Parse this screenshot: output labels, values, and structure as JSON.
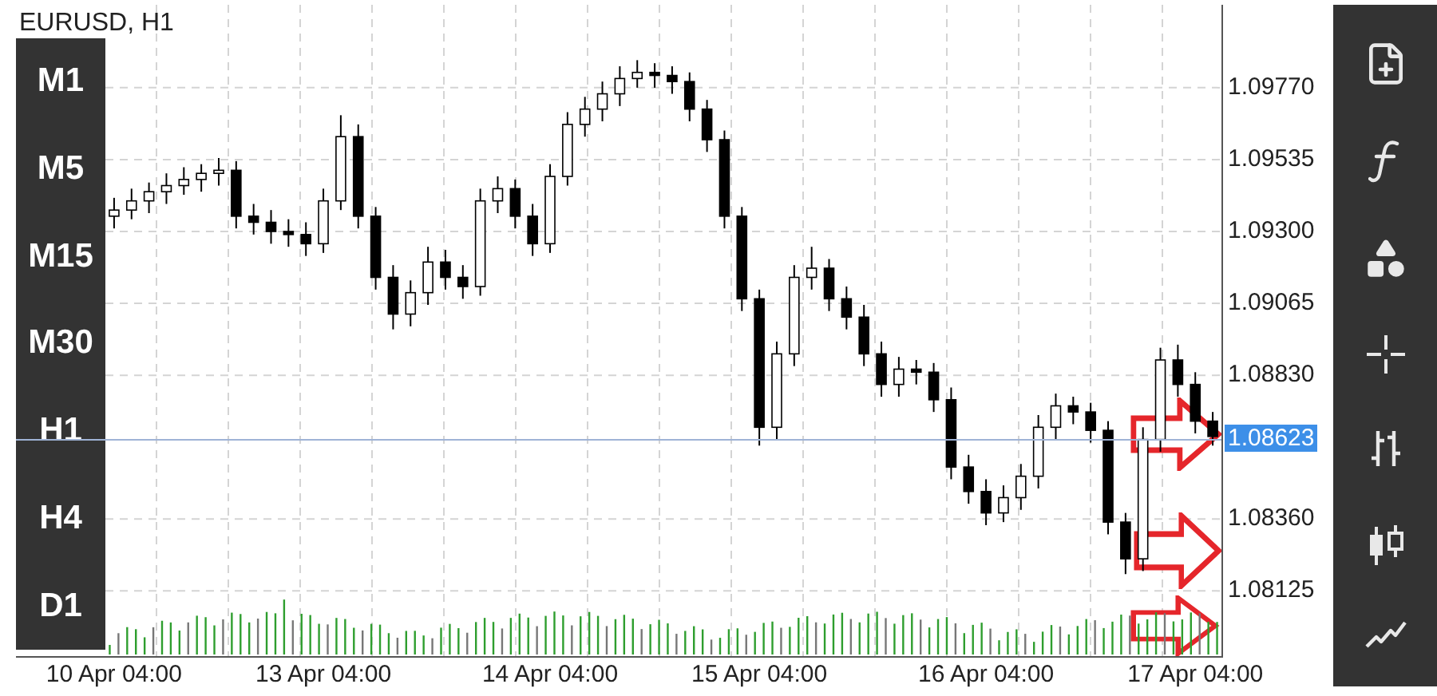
{
  "chart": {
    "title": "EURUSD, H1",
    "timeframes": [
      {
        "label": "M1"
      },
      {
        "label": "M5"
      },
      {
        "label": "M15"
      },
      {
        "label": "M30"
      },
      {
        "label": "H1"
      },
      {
        "label": "H4"
      },
      {
        "label": "D1"
      }
    ],
    "current_price": "1.08623",
    "chart_data": {
      "type": "candlestick",
      "categories": [
        "10 Apr 04:00",
        null,
        null,
        null,
        null,
        null,
        null,
        null,
        null,
        null,
        null,
        null,
        "13 Apr 04:00",
        null,
        null,
        null,
        null,
        null,
        null,
        null,
        null,
        null,
        null,
        null,
        null,
        "14 Apr 04:00",
        null,
        null,
        null,
        null,
        null,
        null,
        null,
        null,
        null,
        null,
        null,
        "15 Apr 04:00",
        null,
        null,
        null,
        null,
        null,
        null,
        null,
        null,
        null,
        null,
        null,
        null,
        "16 Apr 04:00",
        null,
        null,
        null,
        null,
        null,
        null,
        null,
        null,
        null,
        null,
        null,
        "17 Apr 04:00",
        null
      ],
      "ylim": [
        1.07912,
        1.10041
      ],
      "grid": true,
      "ohlc": [
        [
          1.0935,
          1.0941,
          1.0931,
          1.0937
        ],
        [
          1.0937,
          1.0944,
          1.0934,
          1.094
        ],
        [
          1.094,
          1.0946,
          1.0936,
          1.0943
        ],
        [
          1.0943,
          1.0949,
          1.0939,
          1.0945
        ],
        [
          1.0945,
          1.0951,
          1.0942,
          1.0947
        ],
        [
          1.0947,
          1.0952,
          1.0943,
          1.0949
        ],
        [
          1.0949,
          1.0954,
          1.0945,
          1.095
        ],
        [
          1.095,
          1.0953,
          1.0931,
          1.0935
        ],
        [
          1.0935,
          1.0939,
          1.0929,
          1.0933
        ],
        [
          1.0933,
          1.0937,
          1.0926,
          1.093
        ],
        [
          1.093,
          1.0934,
          1.0925,
          1.0929
        ],
        [
          1.0929,
          1.0933,
          1.0922,
          1.0926
        ],
        [
          1.0926,
          1.0944,
          1.0923,
          1.094
        ],
        [
          1.094,
          1.0968,
          1.0937,
          1.0961
        ],
        [
          1.0961,
          1.0965,
          1.0931,
          1.0935
        ],
        [
          1.0935,
          1.0938,
          1.0911,
          1.0915
        ],
        [
          1.0915,
          1.0919,
          1.0898,
          1.0903
        ],
        [
          1.0903,
          1.0914,
          1.0899,
          1.091
        ],
        [
          1.091,
          1.0925,
          1.0906,
          1.092
        ],
        [
          1.092,
          1.0924,
          1.0911,
          1.0915
        ],
        [
          1.0915,
          1.0919,
          1.0908,
          1.0912
        ],
        [
          1.0912,
          1.0944,
          1.0909,
          1.094
        ],
        [
          1.094,
          1.0948,
          1.0936,
          1.0944
        ],
        [
          1.0944,
          1.0947,
          1.0931,
          1.0935
        ],
        [
          1.0935,
          1.0939,
          1.0922,
          1.0926
        ],
        [
          1.0926,
          1.0952,
          1.0923,
          1.0948
        ],
        [
          1.0948,
          1.0969,
          1.0945,
          1.0965
        ],
        [
          1.0965,
          1.0974,
          1.0961,
          1.097
        ],
        [
          1.097,
          1.0979,
          1.0966,
          1.0975
        ],
        [
          1.0975,
          1.0984,
          1.0971,
          1.098
        ],
        [
          1.098,
          1.0986,
          1.0977,
          1.0982
        ],
        [
          1.0982,
          1.0985,
          1.0977,
          1.0981
        ],
        [
          1.0981,
          1.0984,
          1.0975,
          1.0979
        ],
        [
          1.0979,
          1.0982,
          1.0966,
          1.097
        ],
        [
          1.097,
          1.0973,
          1.0956,
          1.096
        ],
        [
          1.096,
          1.0963,
          1.0931,
          1.0935
        ],
        [
          1.0935,
          1.0938,
          1.0904,
          1.0908
        ],
        [
          1.0908,
          1.0911,
          1.086,
          1.0866
        ],
        [
          1.0866,
          1.0894,
          1.0862,
          1.089
        ],
        [
          1.089,
          1.0919,
          1.0886,
          1.0915
        ],
        [
          1.0915,
          1.0925,
          1.0911,
          1.0918
        ],
        [
          1.0918,
          1.0921,
          1.0904,
          1.0908
        ],
        [
          1.0908,
          1.0912,
          1.0898,
          1.0902
        ],
        [
          1.0902,
          1.0906,
          1.0886,
          1.089
        ],
        [
          1.089,
          1.0894,
          1.0876,
          1.088
        ],
        [
          1.088,
          1.0889,
          1.0876,
          1.0885
        ],
        [
          1.0885,
          1.0888,
          1.088,
          1.0884
        ],
        [
          1.0884,
          1.0887,
          1.0871,
          1.0875
        ],
        [
          1.0875,
          1.0879,
          1.0849,
          1.0853
        ],
        [
          1.0853,
          1.0857,
          1.0841,
          1.0845
        ],
        [
          1.0845,
          1.0849,
          1.0834,
          1.0838
        ],
        [
          1.0838,
          1.0847,
          1.0835,
          1.0843
        ],
        [
          1.0843,
          1.0854,
          1.0839,
          1.085
        ],
        [
          1.085,
          1.087,
          1.0846,
          1.0866
        ],
        [
          1.0866,
          1.0877,
          1.0862,
          1.0873
        ],
        [
          1.0873,
          1.0876,
          1.0867,
          1.0871
        ],
        [
          1.0871,
          1.0874,
          1.0861,
          1.0865
        ],
        [
          1.0865,
          1.0868,
          1.0831,
          1.0835
        ],
        [
          1.0835,
          1.0838,
          1.0818,
          1.0823
        ],
        [
          1.0823,
          1.0866,
          1.0819,
          1.0862
        ],
        [
          1.0862,
          1.0892,
          1.0858,
          1.0888
        ],
        [
          1.0888,
          1.0893,
          1.0876,
          1.088
        ],
        [
          1.088,
          1.0884,
          1.0864,
          1.0868
        ],
        [
          1.0868,
          1.0871,
          1.086,
          1.0863
        ]
      ],
      "yticks": [
        {
          "value": 1.0977,
          "label": "1.09770"
        },
        {
          "value": 1.09535,
          "label": "1.09535"
        },
        {
          "value": 1.093,
          "label": "1.09300"
        },
        {
          "value": 1.09065,
          "label": "1.09065"
        },
        {
          "value": 1.0883,
          "label": "1.08830"
        },
        {
          "value": 1.0836,
          "label": "1.08360"
        },
        {
          "value": 1.08125,
          "label": "1.08125"
        }
      ]
    }
  },
  "toolbar": [
    {
      "kind": "new-chart"
    },
    {
      "kind": "indicators"
    },
    {
      "kind": "objects"
    },
    {
      "kind": "crosshair"
    },
    {
      "kind": "bars"
    },
    {
      "kind": "candles"
    },
    {
      "kind": "line"
    }
  ]
}
